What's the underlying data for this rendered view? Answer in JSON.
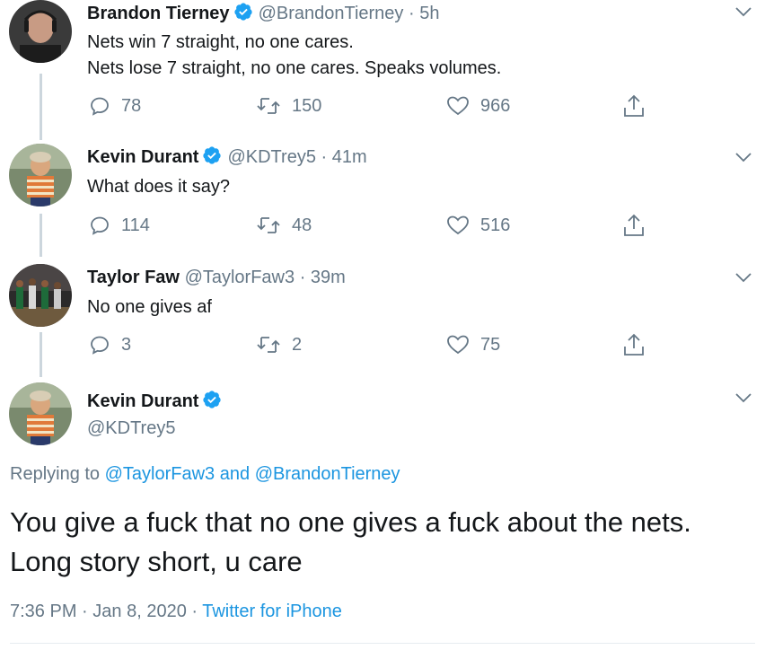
{
  "tweets": [
    {
      "name": "Brandon Tierney",
      "handle": "@BrandonTierney",
      "time": "5h",
      "text_line1": "Nets win 7 straight, no one cares.",
      "text_line2": "Nets lose 7 straight, no one cares. Speaks volumes.",
      "replies": "78",
      "retweets": "150",
      "likes": "966",
      "verified": true
    },
    {
      "name": "Kevin Durant",
      "handle": "@KDTrey5",
      "time": "41m",
      "text_line1": "What does it say?",
      "replies": "114",
      "retweets": "48",
      "likes": "516",
      "verified": true
    },
    {
      "name": "Taylor Faw",
      "handle": "@TaylorFaw3",
      "time": "39m",
      "text_line1": "No one gives af",
      "replies": "3",
      "retweets": "2",
      "likes": "75",
      "verified": false
    }
  ],
  "main_tweet": {
    "name": "Kevin Durant",
    "handle": "@KDTrey5",
    "replying_prefix": "Replying to",
    "replying_user1": "@TaylorFaw3",
    "replying_and": "and",
    "replying_user2": "@BrandonTierney",
    "text": "You give a fuck that no one gives a fuck about the nets. Long story short, u care",
    "time": "7:36 PM",
    "date": "Jan 8, 2020",
    "source": "Twitter for iPhone",
    "separator": "·"
  },
  "separator": "·",
  "colors": {
    "verified_blue": "#1da1f2",
    "link_blue": "#1b95e0",
    "secondary_text": "#657786",
    "thread_line": "#ccd6dd"
  },
  "icons": {
    "reply": "reply-icon",
    "retweet": "retweet-icon",
    "like": "heart-icon",
    "share": "share-icon",
    "more": "chevron-down-icon",
    "verified": "verified-badge-icon"
  }
}
